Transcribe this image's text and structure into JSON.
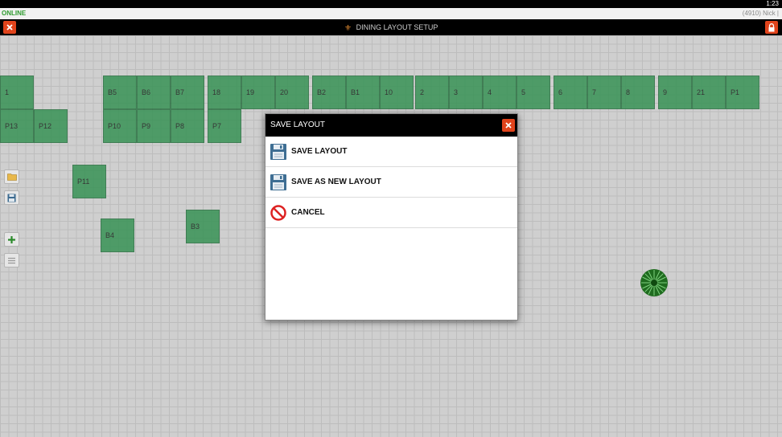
{
  "status_bar": {
    "time": "1:23"
  },
  "info_bar": {
    "connection": "ONLINE",
    "user": "(4910) Nick |"
  },
  "title_bar": {
    "title": "DINING LAYOUT SETUP"
  },
  "tables": {
    "t_1": "1",
    "t_B5": "B5",
    "t_B6": "B6",
    "t_B7": "B7",
    "t_18": "18",
    "t_19": "19",
    "t_20": "20",
    "t_B2": "B2",
    "t_B1": "B1",
    "t_10": "10",
    "t_2": "2",
    "t_3": "3",
    "t_4": "4",
    "t_5": "5",
    "t_6": "6",
    "t_7": "7",
    "t_8": "8",
    "t_9": "9",
    "t_21": "21",
    "t_P1": "P1",
    "t_P13": "P13",
    "t_P12": "P12",
    "t_P10": "P10",
    "t_P9": "P9",
    "t_P8": "P8",
    "t_P7": "P7",
    "t_P11": "P11",
    "t_B4": "B4",
    "t_B3": "B3"
  },
  "modal": {
    "title": "SAVE LAYOUT",
    "items": [
      {
        "label": "SAVE LAYOUT",
        "icon": "floppy-disk-icon"
      },
      {
        "label": "SAVE AS NEW LAYOUT",
        "icon": "floppy-disk-icon"
      },
      {
        "label": "CANCEL",
        "icon": "prohibited-icon"
      }
    ]
  },
  "colors": {
    "table_green": "#2f8f4e",
    "close_red": "#e0431b",
    "online_green": "#2e9b2e"
  }
}
